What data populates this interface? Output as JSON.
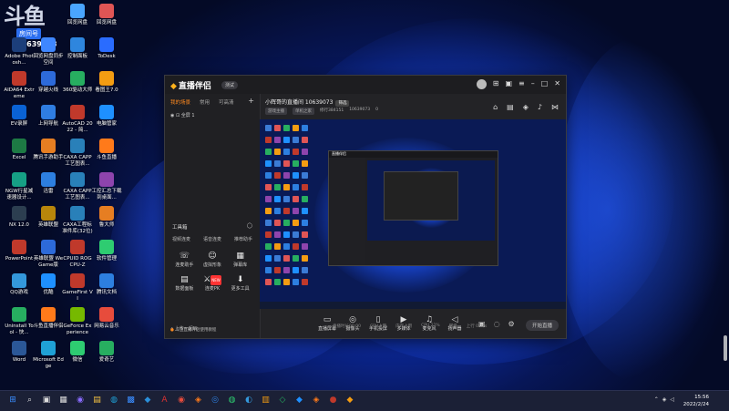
{
  "overlay": {
    "logo": "斗鱼",
    "room_label": "房间号",
    "room_no": "10639073"
  },
  "desktop_icons": [
    {
      "label": "回收站",
      "color": "#3b7bd6",
      "icon": "recycle-bin-icon"
    },
    {
      "label": "索马软件",
      "color": "#2a8fd9",
      "icon": "app-icon"
    },
    {
      "label": "回览网盘",
      "color": "#4aa5ff",
      "icon": "cloud-icon"
    },
    {
      "label": "回览网盘",
      "color": "#e05555",
      "icon": "app-icon"
    },
    {
      "label": "Adobe Photosh...",
      "color": "#1c3e7a",
      "icon": "photoshop-icon"
    },
    {
      "label": "回览网盘同步空间",
      "color": "#3f87ff",
      "icon": "cloud-icon"
    },
    {
      "label": "控制面板",
      "color": "#2e86de",
      "icon": "control-panel-icon"
    },
    {
      "label": "ToDesk",
      "color": "#2a6cff",
      "icon": "todesk-icon"
    },
    {
      "label": "AIDA64 Extreme",
      "color": "#c0392b",
      "icon": "aida64-icon"
    },
    {
      "label": "穿越火线",
      "color": "#2d6ad9",
      "icon": "game-icon"
    },
    {
      "label": "360驱动大师",
      "color": "#27ae60",
      "icon": "driver-icon"
    },
    {
      "label": "看图王7.0",
      "color": "#f39c12",
      "icon": "image-viewer-icon"
    },
    {
      "label": "EV录屏",
      "color": "#0a62d4",
      "icon": "recorder-icon"
    },
    {
      "label": "上网导航",
      "color": "#2f7de1",
      "icon": "browser-icon"
    },
    {
      "label": "AutoCAD 2022 - 简...",
      "color": "#c0392b",
      "icon": "autocad-icon"
    },
    {
      "label": "电脑管家",
      "color": "#1e90ff",
      "icon": "pc-manager-icon"
    },
    {
      "label": "Excel",
      "color": "#1d7a44",
      "icon": "excel-icon"
    },
    {
      "label": "腾讯手游助手",
      "color": "#e67e22",
      "icon": "game-assistant-icon"
    },
    {
      "label": "CAXA CAPP 工艺图表...",
      "color": "#2980b9",
      "icon": "caxa-icon"
    },
    {
      "label": "斗鱼直播",
      "color": "#ff7a1a",
      "icon": "douyu-icon"
    },
    {
      "label": "NGW行星减速器设计...",
      "color": "#16a085",
      "icon": "app-icon"
    },
    {
      "label": "迅雷",
      "color": "#2d7fe0",
      "icon": "thunder-icon"
    },
    {
      "label": "CAXA CAPP 工艺图表...",
      "color": "#2980b9",
      "icon": "caxa-icon"
    },
    {
      "label": "工控汇总下载到桌面...",
      "color": "#8e44ad",
      "icon": "folder-icon"
    },
    {
      "label": "NX 12.0",
      "color": "#2c3e50",
      "icon": "nx-icon"
    },
    {
      "label": "英雄联盟",
      "color": "#b8860b",
      "icon": "lol-icon"
    },
    {
      "label": "CAXA工程标 准件库(32位)",
      "color": "#2980b9",
      "icon": "caxa-icon"
    },
    {
      "label": "鲁大师",
      "color": "#e67e22",
      "icon": "ludashi-icon"
    },
    {
      "label": "PowerPoint",
      "color": "#c0392b",
      "icon": "powerpoint-icon"
    },
    {
      "label": "英雄联盟 WeGame版",
      "color": "#2d6ad9",
      "icon": "wegame-icon"
    },
    {
      "label": "CPUID ROG CPU-Z",
      "color": "#c0392b",
      "icon": "cpuz-icon"
    },
    {
      "label": "软件管理",
      "color": "#2ecc71",
      "icon": "software-manager-icon"
    },
    {
      "label": "QQ游戏",
      "color": "#3498db",
      "icon": "qq-game-icon"
    },
    {
      "label": "优酷",
      "color": "#1e90ff",
      "icon": "youku-icon"
    },
    {
      "label": "GameFirst VI",
      "color": "#c0392b",
      "icon": "gamefirst-icon"
    },
    {
      "label": "腾讯文档",
      "color": "#2d7fe0",
      "icon": "tencent-docs-icon"
    },
    {
      "label": "Uninstall Tool - 快...",
      "color": "#27ae60",
      "icon": "uninstall-icon"
    },
    {
      "label": "斗鱼直播伴侣",
      "color": "#ff7a1a",
      "icon": "douyu-icon"
    },
    {
      "label": "GeForce Experience",
      "color": "#76b900",
      "icon": "geforce-icon"
    },
    {
      "label": "网易云音乐",
      "color": "#e74c3c",
      "icon": "netease-music-icon"
    },
    {
      "label": "Word",
      "color": "#2b5797",
      "icon": "word-icon"
    },
    {
      "label": "Microsoft Edge",
      "color": "#1fa1d6",
      "icon": "edge-icon"
    },
    {
      "label": "微信",
      "color": "#2ecc71",
      "icon": "wechat-icon"
    },
    {
      "label": "爱奇艺",
      "color": "#27ae60",
      "icon": "iqiyi-icon"
    }
  ],
  "app": {
    "brand": "直播伴侣",
    "version": "测试",
    "tabs": [
      "我的场景",
      "常用",
      "可高清"
    ],
    "scene": "全屏 1",
    "toolbox_title": "工具箱",
    "toolbox_tabs": [
      "视频连麦",
      "语音连麦",
      "推荐助手"
    ],
    "tools": [
      {
        "label": "连麦助手",
        "icon": "phone-icon"
      },
      {
        "label": "虚拟形象",
        "icon": "avatar-icon"
      },
      {
        "label": "弹幕库",
        "icon": "danmaku-icon"
      },
      {
        "label": "数据面板",
        "icon": "data-icon"
      },
      {
        "label": "连麦PK",
        "icon": "pk-icon",
        "badge": "NEW"
      },
      {
        "label": "更多工具",
        "icon": "download-icon"
      }
    ],
    "link_label": "上传一起玩",
    "footer_note": "斗鱼直播伴侣使用教程",
    "room_title": "小辉哥的直播间 10639073",
    "room_badge": "筛选",
    "room_meta": [
      "游戏主播",
      "单机之家",
      "修行384151",
      "10639073",
      "0"
    ],
    "controls": [
      {
        "label": "直播屏幕",
        "icon": "screen-icon"
      },
      {
        "label": "摄像头",
        "icon": "camera-icon"
      },
      {
        "label": "手机投屏",
        "icon": "mobile-icon"
      },
      {
        "label": "多媒体",
        "icon": "media-icon"
      },
      {
        "label": "麦克风",
        "icon": "mic-icon"
      },
      {
        "label": "扬声器",
        "icon": "speaker-icon"
      }
    ],
    "live_button": "开始直播",
    "status": [
      "直播时长00:00",
      "CPU占用",
      "内存占用",
      "CPU 21%",
      "网络",
      "上行 0kb/s"
    ]
  },
  "taskbar": {
    "time": "15:56",
    "date": "2022/2/24"
  }
}
